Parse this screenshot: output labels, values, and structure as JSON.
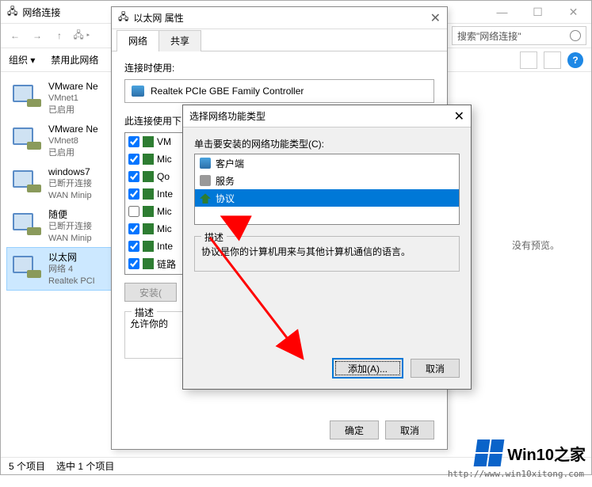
{
  "explorer": {
    "title": "网络连接",
    "search_placeholder": "搜索\"网络连接\"",
    "cmd_organize": "组织 ▾",
    "cmd_disable": "禁用此网络",
    "preview_empty": "没有预览。",
    "status_count": "5 个项目",
    "status_selected": "选中 1 个项目",
    "winbtns": {
      "min": "—",
      "max": "☐",
      "close": "✕"
    },
    "items": [
      {
        "name": "VMware Ne",
        "sub": "VMnet1",
        "sub2": "已启用"
      },
      {
        "name": "VMware Ne",
        "sub": "VMnet8",
        "sub2": "已启用"
      },
      {
        "name": "windows7",
        "sub": "已断开连接",
        "sub2": "WAN Minip"
      },
      {
        "name": "随便",
        "sub": "已断开连接",
        "sub2": "WAN Minip"
      },
      {
        "name": "以太网",
        "sub": "网络 4",
        "sub2": "Realtek PCI"
      }
    ]
  },
  "props": {
    "title": "以太网 属性",
    "tab_network": "网络",
    "tab_share": "共享",
    "connect_using": "连接时使用:",
    "adapter": "Realtek PCIe GBE Family Controller",
    "list_label": "此连接使用下",
    "components": [
      {
        "checked": true,
        "label": "VM"
      },
      {
        "checked": true,
        "label": "Mic"
      },
      {
        "checked": true,
        "label": "Qo"
      },
      {
        "checked": true,
        "label": "Inte"
      },
      {
        "checked": false,
        "label": "Mic"
      },
      {
        "checked": true,
        "label": "Mic"
      },
      {
        "checked": true,
        "label": "Inte"
      },
      {
        "checked": true,
        "label": "链路"
      }
    ],
    "btn_install": "安装(",
    "desc_title": "描述",
    "desc_text": "允许你的",
    "btn_ok": "确定",
    "btn_cancel": "取消"
  },
  "seltype": {
    "title": "选择网络功能类型",
    "list_label": "单击要安装的网络功能类型(C):",
    "types": [
      {
        "label": "客户端",
        "icon": "blue",
        "selected": false
      },
      {
        "label": "服务",
        "icon": "grey",
        "selected": false
      },
      {
        "label": "协议",
        "icon": "green",
        "selected": true
      }
    ],
    "desc_title": "描述",
    "desc_text": "协议是你的计算机用来与其他计算机通信的语言。",
    "btn_add": "添加(A)...",
    "btn_cancel": "取消"
  },
  "logo": {
    "text": "Win10之家",
    "url": "http://www.win10xitong.com"
  }
}
